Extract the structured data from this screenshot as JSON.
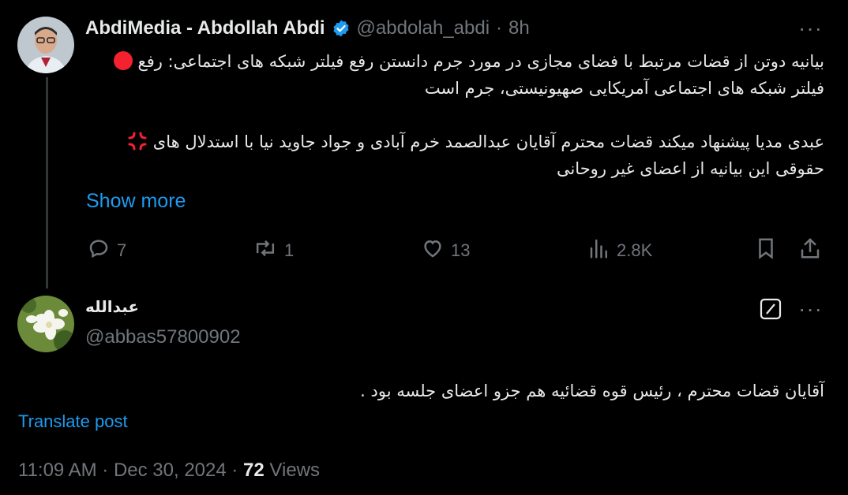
{
  "parent": {
    "display_name": "AbdiMedia - Abdollah Abdi",
    "handle": "@abdolah_abdi",
    "separator": "·",
    "time": "8h",
    "line1": "بیانیه دوتن از قضات مرتبط با فضای مجازی در مورد جرم دانستن رفع فیلتر شبکه های اجتماعی: رفع",
    "line2": "فیلتر شبکه های اجتماعی آمریکایی صهیونیستی، جرم است",
    "line3": "عبدی مدیا پیشنهاد میکند قضات محترم آقایان عبدالصمد خرم آبادی و جواد جاوید نیا با استدلال های",
    "line4": "حقوقی این بیانیه از اعضای غیر روحانی",
    "show_more": "Show more",
    "replies": "7",
    "reposts": "1",
    "likes": "13",
    "views": "2.8K"
  },
  "reply": {
    "display_name": "عبدالله",
    "handle": "@abbas57800902",
    "text": "آقایان قضات محترم ، رئیس قوه قضائیه هم جزو اعضای جلسه بود .",
    "translate": "Translate post",
    "timestamp": "11:09 AM · Dec 30, 2024 · ",
    "view_count": "72",
    "views_label": " Views"
  },
  "colors": {
    "accent": "#1d9bf0",
    "muted": "#71767b",
    "text": "#e7e9ea",
    "red": "#f4212e"
  }
}
